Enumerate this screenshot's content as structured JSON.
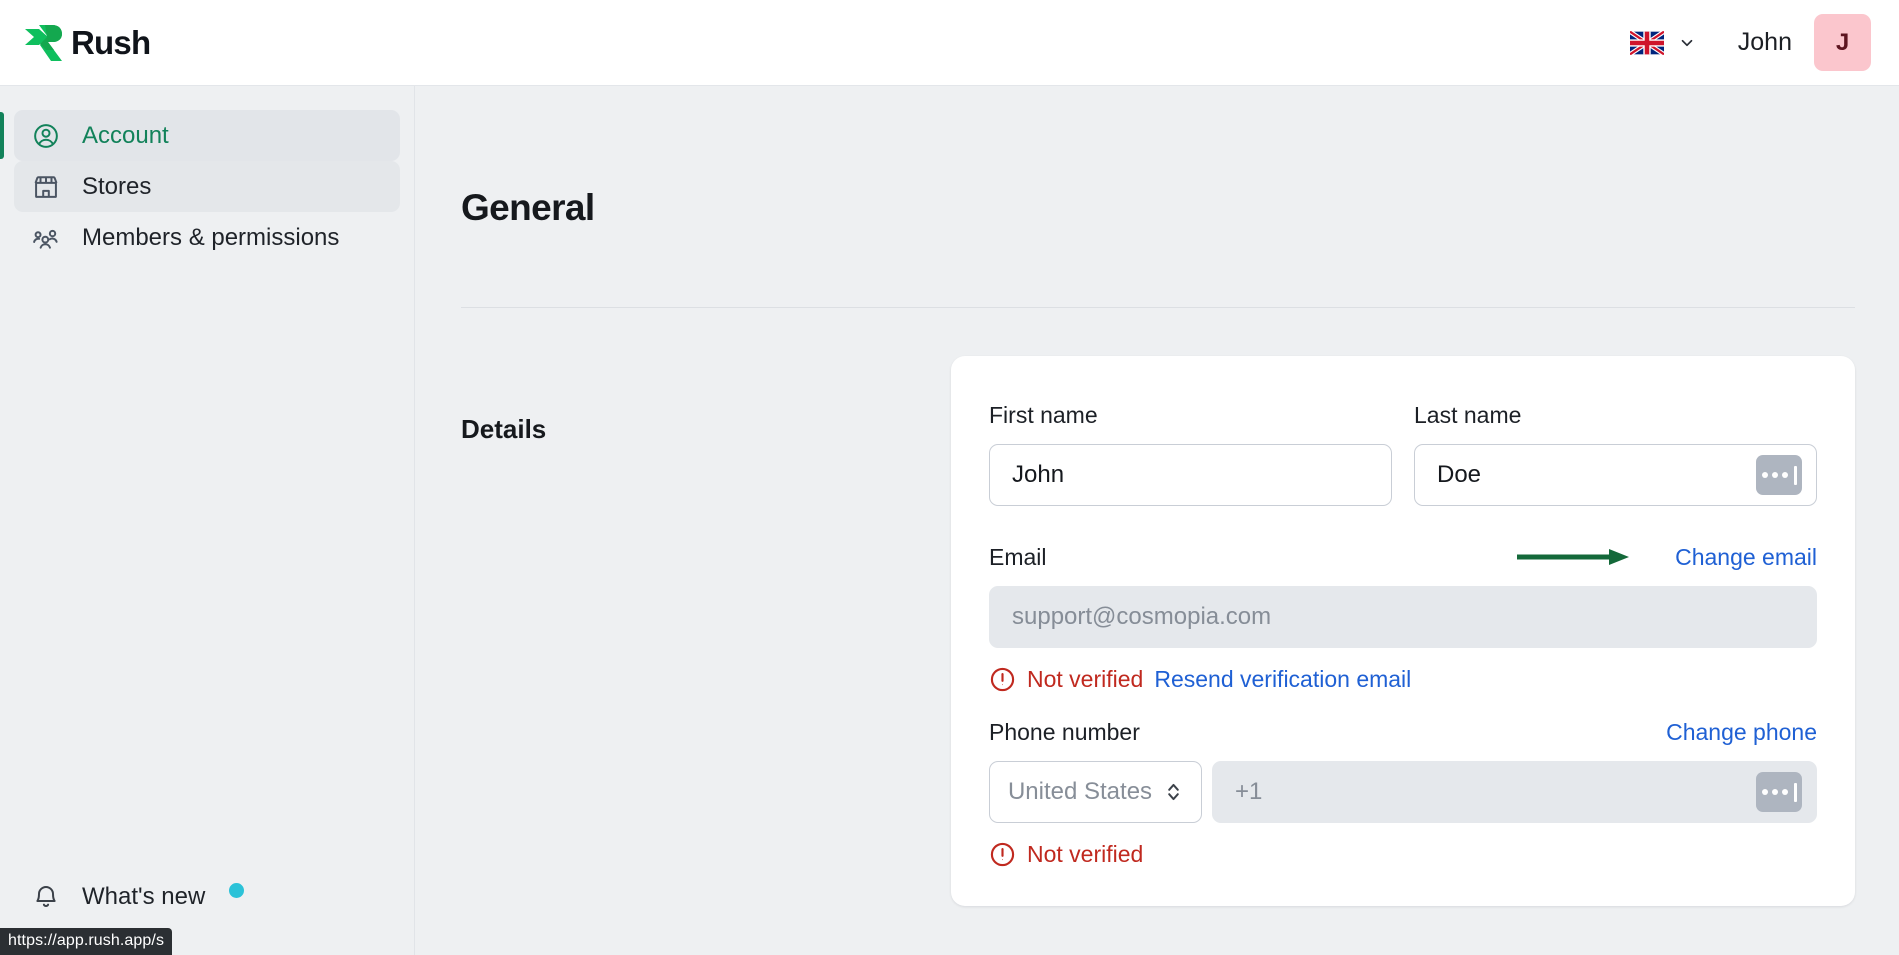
{
  "header": {
    "brand_name": "Rush",
    "language": {
      "icon": "uk-flag-icon",
      "chevron": "chevron-down-icon"
    },
    "user_name": "John",
    "avatar_initial": "J",
    "avatar_color": "#fbc6cd"
  },
  "sidebar": {
    "items": [
      {
        "label": "Account",
        "icon": "user-circle-icon",
        "active": true
      },
      {
        "label": "Stores",
        "icon": "store-icon",
        "active": false
      },
      {
        "label": "Members & permissions",
        "icon": "users-group-icon",
        "active": false
      }
    ],
    "whats_new": {
      "label": "What's new",
      "icon": "bell-icon",
      "badge": true
    }
  },
  "main": {
    "page_title": "General",
    "section_label": "Details",
    "first_name": {
      "label": "First name",
      "value": "John",
      "placeholder": "First name"
    },
    "last_name": {
      "label": "Last name",
      "value": "Doe",
      "placeholder": "Last name"
    },
    "email": {
      "label": "Email",
      "value": "support@cosmopia.com",
      "placeholder": "support@cosmopia.com",
      "change_link": "Change email",
      "status": "Not verified",
      "resend_link": "Resend verification email"
    },
    "phone": {
      "label": "Phone number",
      "change_link": "Change phone",
      "country": "United States",
      "value": "+1",
      "placeholder": "+1",
      "status": "Not verified"
    }
  },
  "status_bar": {
    "url": "https://app.rush.app/s"
  },
  "colors": {
    "accent_green": "#12825a",
    "link_blue": "#1f60d4",
    "error_red": "#c0291f",
    "annotation_green": "#14693a",
    "badge_cyan": "#2bc2d8"
  }
}
